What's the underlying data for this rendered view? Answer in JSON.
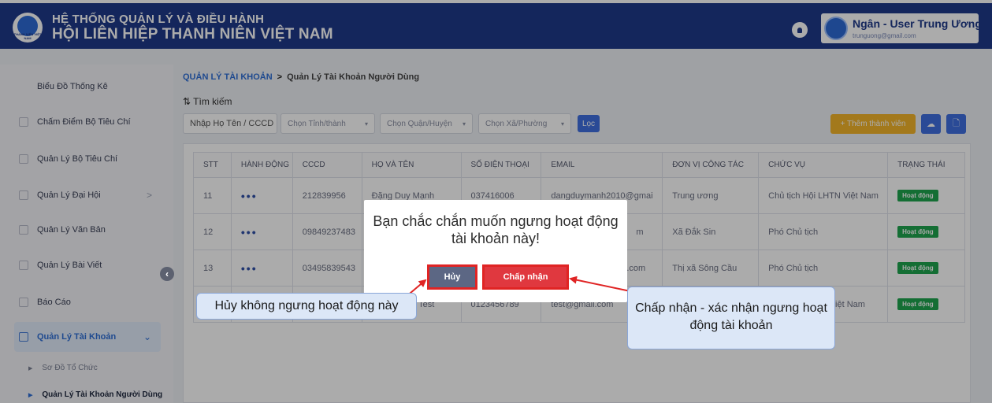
{
  "header": {
    "title_line1": "HỆ THỐNG QUẢN LÝ VÀ ĐIỀU HÀNH",
    "title_line2": "HỘI LIÊN HIỆP THANH NIÊN VIỆT NAM",
    "logo_text": "THANH NIÊN VIỆT NAM",
    "user_name": "Ngân - User Trung Ương",
    "user_email": "trunguong@gmail.com",
    "bell_icon": "bell-icon"
  },
  "sidebar": {
    "items": [
      {
        "label": "Biểu Đồ Thống Kê"
      },
      {
        "label": "Chấm Điểm Bộ Tiêu Chí"
      },
      {
        "label": "Quản Lý Bộ Tiêu Chí"
      },
      {
        "label": "Quản Lý Đại Hội",
        "chevron": ">"
      },
      {
        "label": "Quản Lý Văn Bản"
      },
      {
        "label": "Quản Lý Bài Viết"
      },
      {
        "label": "Báo Cáo"
      },
      {
        "label": "Quản Lý Tài Khoản",
        "chevron": "⌄"
      }
    ],
    "sub_items": [
      {
        "label": "Sơ Đồ Tổ Chức"
      },
      {
        "label": "Quản Lý Tài Khoản Người Dùng"
      }
    ]
  },
  "breadcrumb": {
    "root": "QUẢN LÝ TÀI KHOẢN",
    "separator": ">",
    "current": "Quản Lý Tài Khoản Người Dùng"
  },
  "search": {
    "title": "⇅ Tìm kiếm",
    "name_placeholder": "Nhập Họ Tên / CCCD",
    "province_placeholder": "Chọn Tỉnh/thành",
    "district_placeholder": "Chọn Quận/Huyện",
    "ward_placeholder": "Chọn Xã/Phường",
    "filter_label": "Lọc",
    "add_member_label": "+ Thêm thành viên",
    "upload_icon": "☁",
    "doc_icon": "🗋"
  },
  "table": {
    "headers": [
      "STT",
      "HÀNH ĐỘNG",
      "CCCD",
      "HỌ VÀ TÊN",
      "SỐ ĐIỆN THOẠI",
      "EMAIL",
      "ĐƠN VỊ CÔNG TÁC",
      "CHỨC VỤ",
      "TRẠNG THÁI"
    ],
    "rows": [
      {
        "stt": "11",
        "action": "•••",
        "cccd": "212839956",
        "name": "Đặng Duy Mạnh",
        "phone": "037416006",
        "email": "dangduymanh2010@gmai",
        "unit": "Trung ương",
        "position": "Chủ tịch Hội LHTN Việt Nam",
        "status": "Hoạt động"
      },
      {
        "stt": "12",
        "action": "•••",
        "cccd": "09849237483",
        "name": "",
        "phone": "",
        "email": "m",
        "unit": "Xã Đắk Sin",
        "position": "Phó Chủ tịch",
        "status": "Hoạt động"
      },
      {
        "stt": "13",
        "action": "•••",
        "cccd": "03495839543",
        "name": "",
        "phone": "",
        "email": ".com",
        "unit": "Thị xã Sông Cầu",
        "position": "Phó Chủ tịch",
        "status": "Hoạt động"
      },
      {
        "stt": "",
        "action": "",
        "cccd": "",
        "name": "ui Test",
        "phone": "0123456789",
        "email": "test@gmail.com",
        "unit": "",
        "position": "TN Việt Nam",
        "status": "Hoạt động"
      }
    ]
  },
  "modal": {
    "message": "Bạn chắc chắn muốn ngưng hoạt động tài khoản này!",
    "cancel_label": "Hủy",
    "accept_label": "Chấp nhận"
  },
  "callouts": {
    "left": "Hủy không ngưng hoạt động này",
    "right": "Chấp nhận - xác nhận ngưng hoạt động tài khoản"
  },
  "colors": {
    "header_bg": "#1f3a8a",
    "accent": "#2f6fd6",
    "status_green": "#1ea44e",
    "highlight_red": "#e02424"
  }
}
